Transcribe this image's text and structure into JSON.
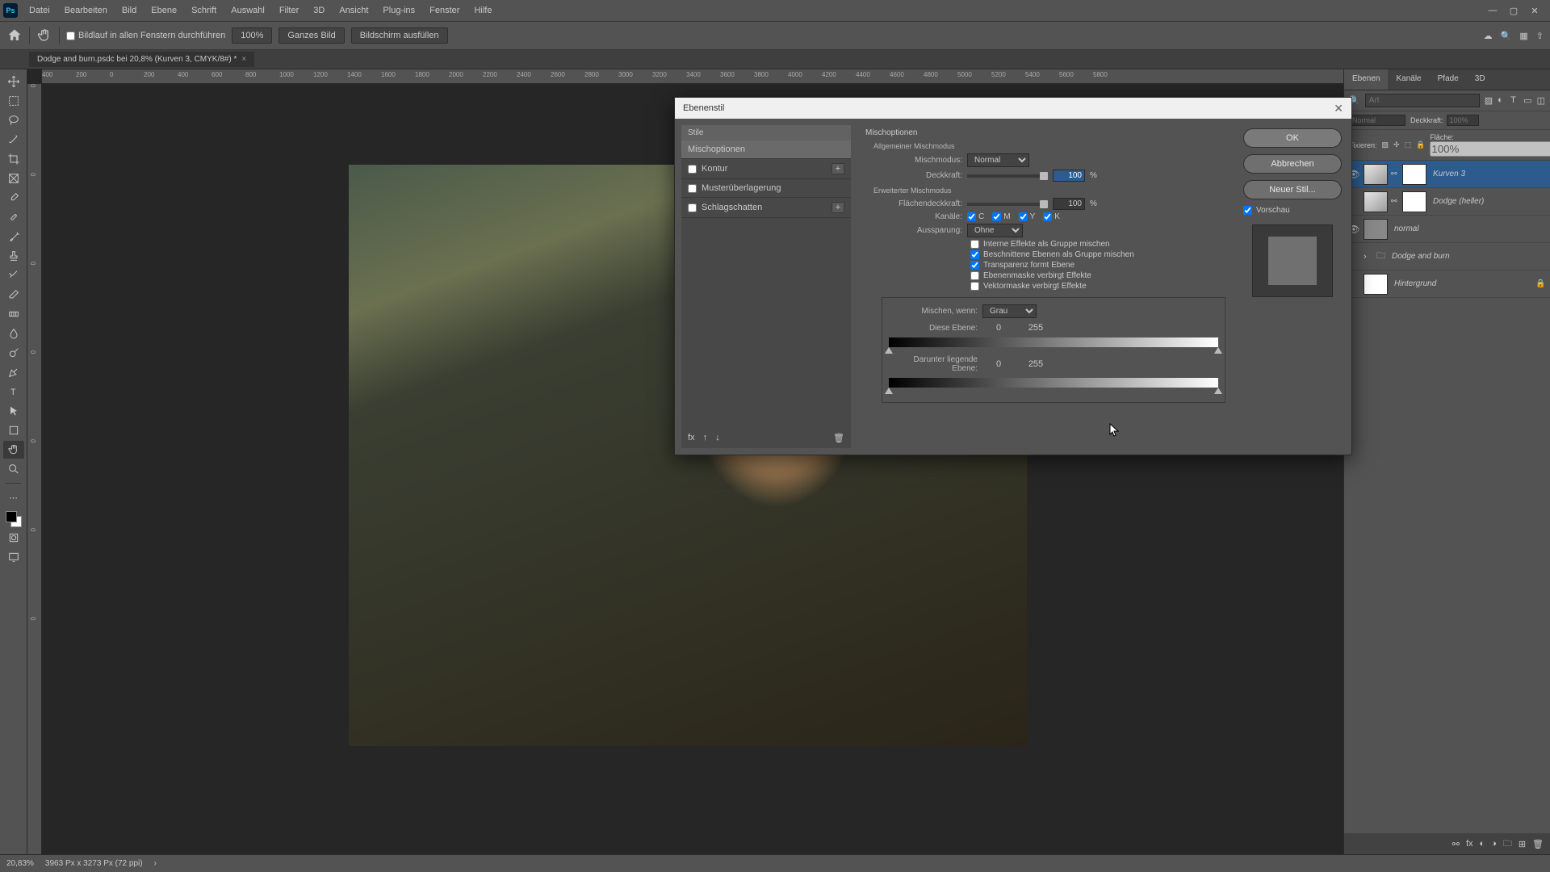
{
  "menu": {
    "items": [
      "Datei",
      "Bearbeiten",
      "Bild",
      "Ebene",
      "Schrift",
      "Auswahl",
      "Filter",
      "3D",
      "Ansicht",
      "Plug-ins",
      "Fenster",
      "Hilfe"
    ]
  },
  "optbar": {
    "scroll_all": "Bildlauf in allen Fenstern durchführen",
    "zoom": "100%",
    "fit": "Ganzes Bild",
    "fill": "Bildschirm ausfüllen"
  },
  "doc": {
    "title": "Dodge and burn.psdc bei 20,8% (Kurven 3, CMYK/8#) *"
  },
  "ruler_h": [
    "400",
    "200",
    "0",
    "200",
    "400",
    "600",
    "800",
    "1000",
    "1200",
    "1400",
    "1600",
    "1800",
    "2000",
    "2200",
    "2400",
    "2600",
    "2800",
    "3000",
    "3200",
    "3400",
    "3600",
    "3800",
    "4000",
    "4200",
    "4400",
    "4600",
    "4800",
    "5000",
    "5200",
    "5400",
    "5600",
    "5800"
  ],
  "ruler_v": [
    "0",
    "0",
    "0",
    "0",
    "0",
    "0",
    "0"
  ],
  "panels": {
    "tabs": [
      "Ebenen",
      "Kanäle",
      "Pfade",
      "3D"
    ],
    "search_ph": "Art",
    "mode_label": "Normal",
    "opacity_label": "Deckkraft:",
    "opacity_val": "100%",
    "lock_label": "Fixieren:",
    "fill_label": "Fläche:",
    "fill_val": "100%",
    "layers": [
      {
        "name": "Kurven 3",
        "visible": true,
        "selected": true,
        "type": "adjust"
      },
      {
        "name": "Dodge (heller)",
        "visible": false,
        "selected": false,
        "type": "adjust"
      },
      {
        "name": "normal",
        "visible": true,
        "selected": false,
        "type": "image"
      },
      {
        "name": "Dodge and burn",
        "visible": false,
        "selected": false,
        "type": "group"
      },
      {
        "name": "Hintergrund",
        "visible": false,
        "selected": false,
        "type": "bg",
        "locked": true
      }
    ]
  },
  "dialog": {
    "title": "Ebenenstil",
    "left": {
      "styles": "Stile",
      "blending": "Mischoptionen",
      "items": [
        {
          "label": "Kontur",
          "plus": true
        },
        {
          "label": "Musterüberlagerung",
          "plus": false
        },
        {
          "label": "Schlagschatten",
          "plus": true
        }
      ]
    },
    "mid": {
      "title": "Mischoptionen",
      "general": "Allgemeiner Mischmodus",
      "mode_label": "Mischmodus:",
      "mode_val": "Normal",
      "opacity_label": "Deckkraft:",
      "opacity_val": "100",
      "pct": "%",
      "advanced": "Erweiterter Mischmodus",
      "fillop_label": "Flächendeckkraft:",
      "fillop_val": "100",
      "channels_label": "Kanäle:",
      "channels": [
        "C",
        "M",
        "Y",
        "K"
      ],
      "knockout_label": "Aussparung:",
      "knockout_val": "Ohne",
      "opts": [
        {
          "label": "Interne Effekte als Gruppe mischen",
          "checked": false
        },
        {
          "label": "Beschnittene Ebenen als Gruppe mischen",
          "checked": true
        },
        {
          "label": "Transparenz formt Ebene",
          "checked": true
        },
        {
          "label": "Ebenenmaske verbirgt Effekte",
          "checked": false
        },
        {
          "label": "Vektormaske verbirgt Effekte",
          "checked": false
        }
      ],
      "blendif_label": "Mischen, wenn:",
      "blendif_val": "Grau",
      "this_label": "Diese Ebene:",
      "this_lo": "0",
      "this_hi": "255",
      "under_label": "Darunter liegende Ebene:",
      "under_lo": "0",
      "under_hi": "255"
    },
    "right": {
      "ok": "OK",
      "cancel": "Abbrechen",
      "newstyle": "Neuer Stil...",
      "preview": "Vorschau"
    }
  },
  "status": {
    "zoom": "20,83%",
    "info": "3963 Px x 3273 Px (72 ppi)"
  }
}
